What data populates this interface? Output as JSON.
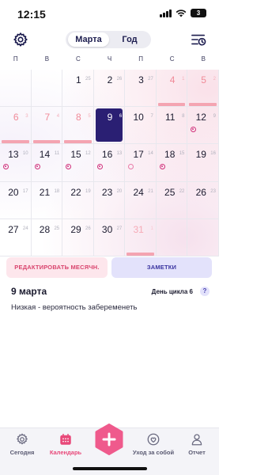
{
  "status_bar": {
    "time": "12:15",
    "battery": "3"
  },
  "header": {
    "segments": [
      {
        "label": "Марта"
      },
      {
        "label": "Год"
      }
    ]
  },
  "weekdays": [
    "П",
    "В",
    "С",
    "Ч",
    "П",
    "С",
    "В"
  ],
  "calendar": {
    "rows": [
      [
        null,
        null,
        {
          "day": "1",
          "sub": "25"
        },
        {
          "day": "2",
          "sub": "26"
        },
        {
          "day": "3",
          "sub": "27"
        },
        {
          "day": "4",
          "sub": "1",
          "state": "pink"
        },
        {
          "day": "5",
          "sub": "2",
          "state": "pink"
        }
      ],
      [
        {
          "day": "6",
          "sub": "3",
          "state": "pink"
        },
        {
          "day": "7",
          "sub": "4",
          "state": "pink"
        },
        {
          "day": "8",
          "sub": "5",
          "state": "pink"
        },
        {
          "day": "9",
          "sub": "6",
          "state": "today"
        },
        {
          "day": "10",
          "sub": "7"
        },
        {
          "day": "11",
          "sub": "8"
        },
        {
          "day": "12",
          "sub": "9",
          "ovulation": true
        }
      ],
      [
        {
          "day": "13",
          "sub": "10",
          "ovulation": true
        },
        {
          "day": "14",
          "sub": "11",
          "ovulation": true
        },
        {
          "day": "15",
          "sub": "12",
          "ovulation": true
        },
        {
          "day": "16",
          "sub": "13",
          "ovulation": true
        },
        {
          "day": "17",
          "sub": "14",
          "ovulation": "light"
        },
        {
          "day": "18",
          "sub": "15",
          "ovulation": true
        },
        {
          "day": "19",
          "sub": "16"
        }
      ],
      [
        {
          "day": "20",
          "sub": "17"
        },
        {
          "day": "21",
          "sub": "18"
        },
        {
          "day": "22",
          "sub": "19"
        },
        {
          "day": "23",
          "sub": "20"
        },
        {
          "day": "24",
          "sub": "21"
        },
        {
          "day": "25",
          "sub": "22"
        },
        {
          "day": "26",
          "sub": "23"
        }
      ],
      [
        {
          "day": "27",
          "sub": "24"
        },
        {
          "day": "28",
          "sub": "25"
        },
        {
          "day": "29",
          "sub": "26"
        },
        {
          "day": "30",
          "sub": "27"
        },
        {
          "day": "31",
          "sub": "1",
          "state": "future"
        },
        null,
        null
      ]
    ]
  },
  "actions": {
    "edit_label": "РЕДАКТИРОВАТЬ МЕСЯЧН.",
    "notes_label": "ЗАМЕТКИ"
  },
  "day_info": {
    "date": "9 марта",
    "cycle_day": "День цикла 6",
    "help": "?",
    "probability": "Низкая - вероятность забеременеть"
  },
  "tabbar": {
    "tabs": [
      {
        "label": "Сегодня",
        "icon": "gear-icon"
      },
      {
        "label": "Календарь",
        "icon": "calendar-icon"
      },
      {
        "label": "Уход за собой",
        "icon": "self-care-icon"
      },
      {
        "label": "Отчет",
        "icon": "user-report-icon"
      }
    ]
  },
  "colors": {
    "accent": "#e8497a",
    "today": "#2a1f73",
    "period": "#f4a4b1",
    "ovulation": "#d0307a"
  }
}
